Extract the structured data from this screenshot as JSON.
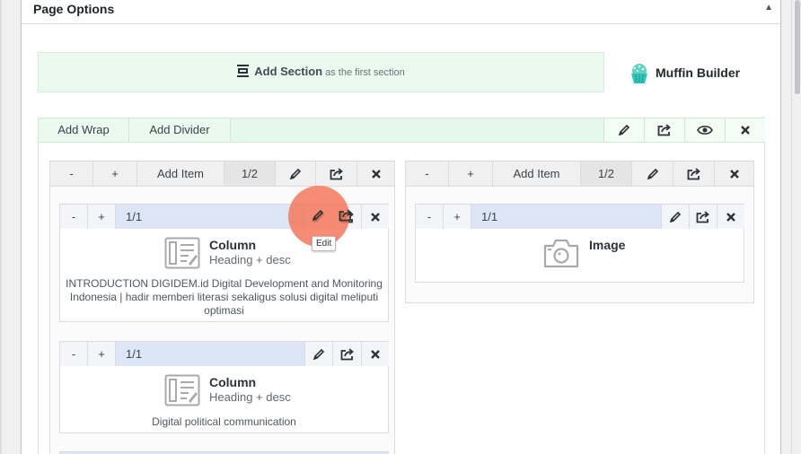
{
  "panel": {
    "title": "Page Options",
    "toggle_icon": "caret-up-icon"
  },
  "add_section": {
    "label": "Add Section",
    "sub": "as the first section"
  },
  "logo": {
    "text": "Muffin Builder",
    "color": "#2ec4b6"
  },
  "wrap_bar": {
    "add_wrap": "Add Wrap",
    "add_divider": "Add Divider",
    "icons": [
      "pencil-icon",
      "export-icon",
      "eye-icon",
      "close-icon"
    ]
  },
  "wraps": [
    {
      "minus": "-",
      "plus": "+",
      "add_item": "Add Item",
      "size": "1/2",
      "items": [
        {
          "minus": "-",
          "plus": "+",
          "size": "1/1",
          "title": "Column",
          "sub": "Heading + desc",
          "desc": "INTRODUCTION DIGIDEM.id Digital Development and Monitoring Indonesia | hadir memberi literasi sekaligus solusi digital meliputi optimasi"
        },
        {
          "minus": "-",
          "plus": "+",
          "size": "1/1",
          "title": "Column",
          "sub": "Heading + desc",
          "desc": "Digital political communication"
        }
      ]
    },
    {
      "minus": "-",
      "plus": "+",
      "add_item": "Add Item",
      "size": "1/2",
      "items": [
        {
          "minus": "-",
          "plus": "+",
          "size": "1/1",
          "title": "Image"
        }
      ]
    }
  ],
  "tooltip": "Edit",
  "colors": {
    "accent_green": "#eafaef",
    "item_bar_blue": "#dde6f6",
    "highlight": "#f47354"
  }
}
